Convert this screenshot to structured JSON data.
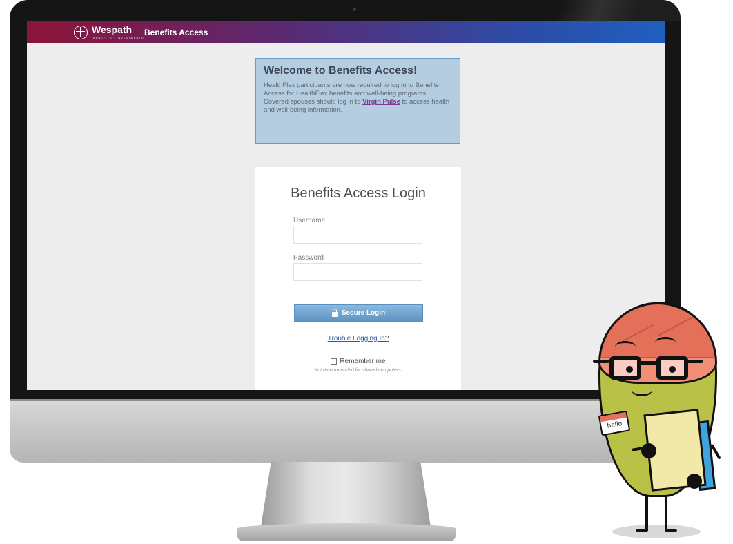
{
  "header": {
    "brand_name": "Wespath",
    "brand_tagline": "BENEFITS · INVESTMENTS",
    "app_name": "Benefits Access"
  },
  "welcome": {
    "title": "Welcome to Benefits Access!",
    "body_before_link": "HealthFlex participants are now required to log in to Benefits Access for HealthFlex benefits and well-being programs. Covered spouses should log in to ",
    "link_text": "Virgin Pulse",
    "body_after_link": " to access health and well-being information."
  },
  "login": {
    "title": "Benefits Access Login",
    "username_label": "Username",
    "username_value": "",
    "password_label": "Password",
    "password_value": "",
    "login_button": "Secure Login",
    "trouble_link": "Trouble Logging In?",
    "remember_label": "Remember me",
    "remember_checked": false,
    "remember_note": "Not recommended for shared computers."
  },
  "mascot": {
    "name_tag": "hello"
  },
  "colors": {
    "header_start": "#8c1437",
    "header_end": "#1f5fbf",
    "welcome_bg": "#b5cde0",
    "button": "#6fa3d0",
    "page_bg": "#ededed"
  },
  "icons": [
    "wespath-logo-icon",
    "lock-icon",
    "checkbox-icon"
  ]
}
